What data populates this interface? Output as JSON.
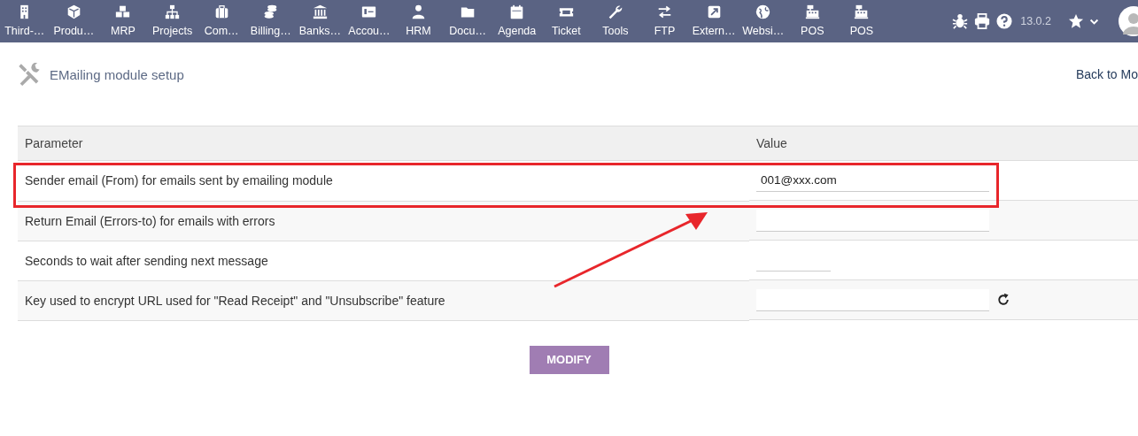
{
  "top_menu": [
    {
      "label": "Third-…"
    },
    {
      "label": "Produ…"
    },
    {
      "label": "MRP"
    },
    {
      "label": "Projects"
    },
    {
      "label": "Com…"
    },
    {
      "label": "Billing…"
    },
    {
      "label": "Banks…"
    },
    {
      "label": "Accou…"
    },
    {
      "label": "HRM"
    },
    {
      "label": "Docu…"
    },
    {
      "label": "Agenda"
    },
    {
      "label": "Ticket"
    },
    {
      "label": "Tools"
    },
    {
      "label": "FTP"
    },
    {
      "label": "Extern…"
    },
    {
      "label": "Websi…"
    },
    {
      "label": "POS"
    },
    {
      "label": "POS"
    }
  ],
  "version": "13.0.2",
  "page": {
    "title": "EMailing module setup",
    "back_link": "Back to Mo"
  },
  "table": {
    "columns": [
      "Parameter",
      "Value"
    ],
    "rows": [
      {
        "parameter": "Sender email (From) for emails sent by emailing module",
        "value": "001@xxx.com",
        "kind": "wide",
        "generate_button": false,
        "highlighted": true
      },
      {
        "parameter": "Return Email (Errors-to) for emails with errors",
        "kind": "wide",
        "generate_button": false,
        "highlighted": false
      },
      {
        "parameter": "Seconds to wait after sending next message",
        "kind": "narrow",
        "generate_button": false,
        "highlighted": false
      },
      {
        "parameter": "Key used to encrypt URL used for \"Read Receipt\" and \"Unsubscribe\" feature",
        "kind": "wide",
        "generate_button": true,
        "highlighted": false
      }
    ]
  },
  "submit_button": "MODIFY"
}
